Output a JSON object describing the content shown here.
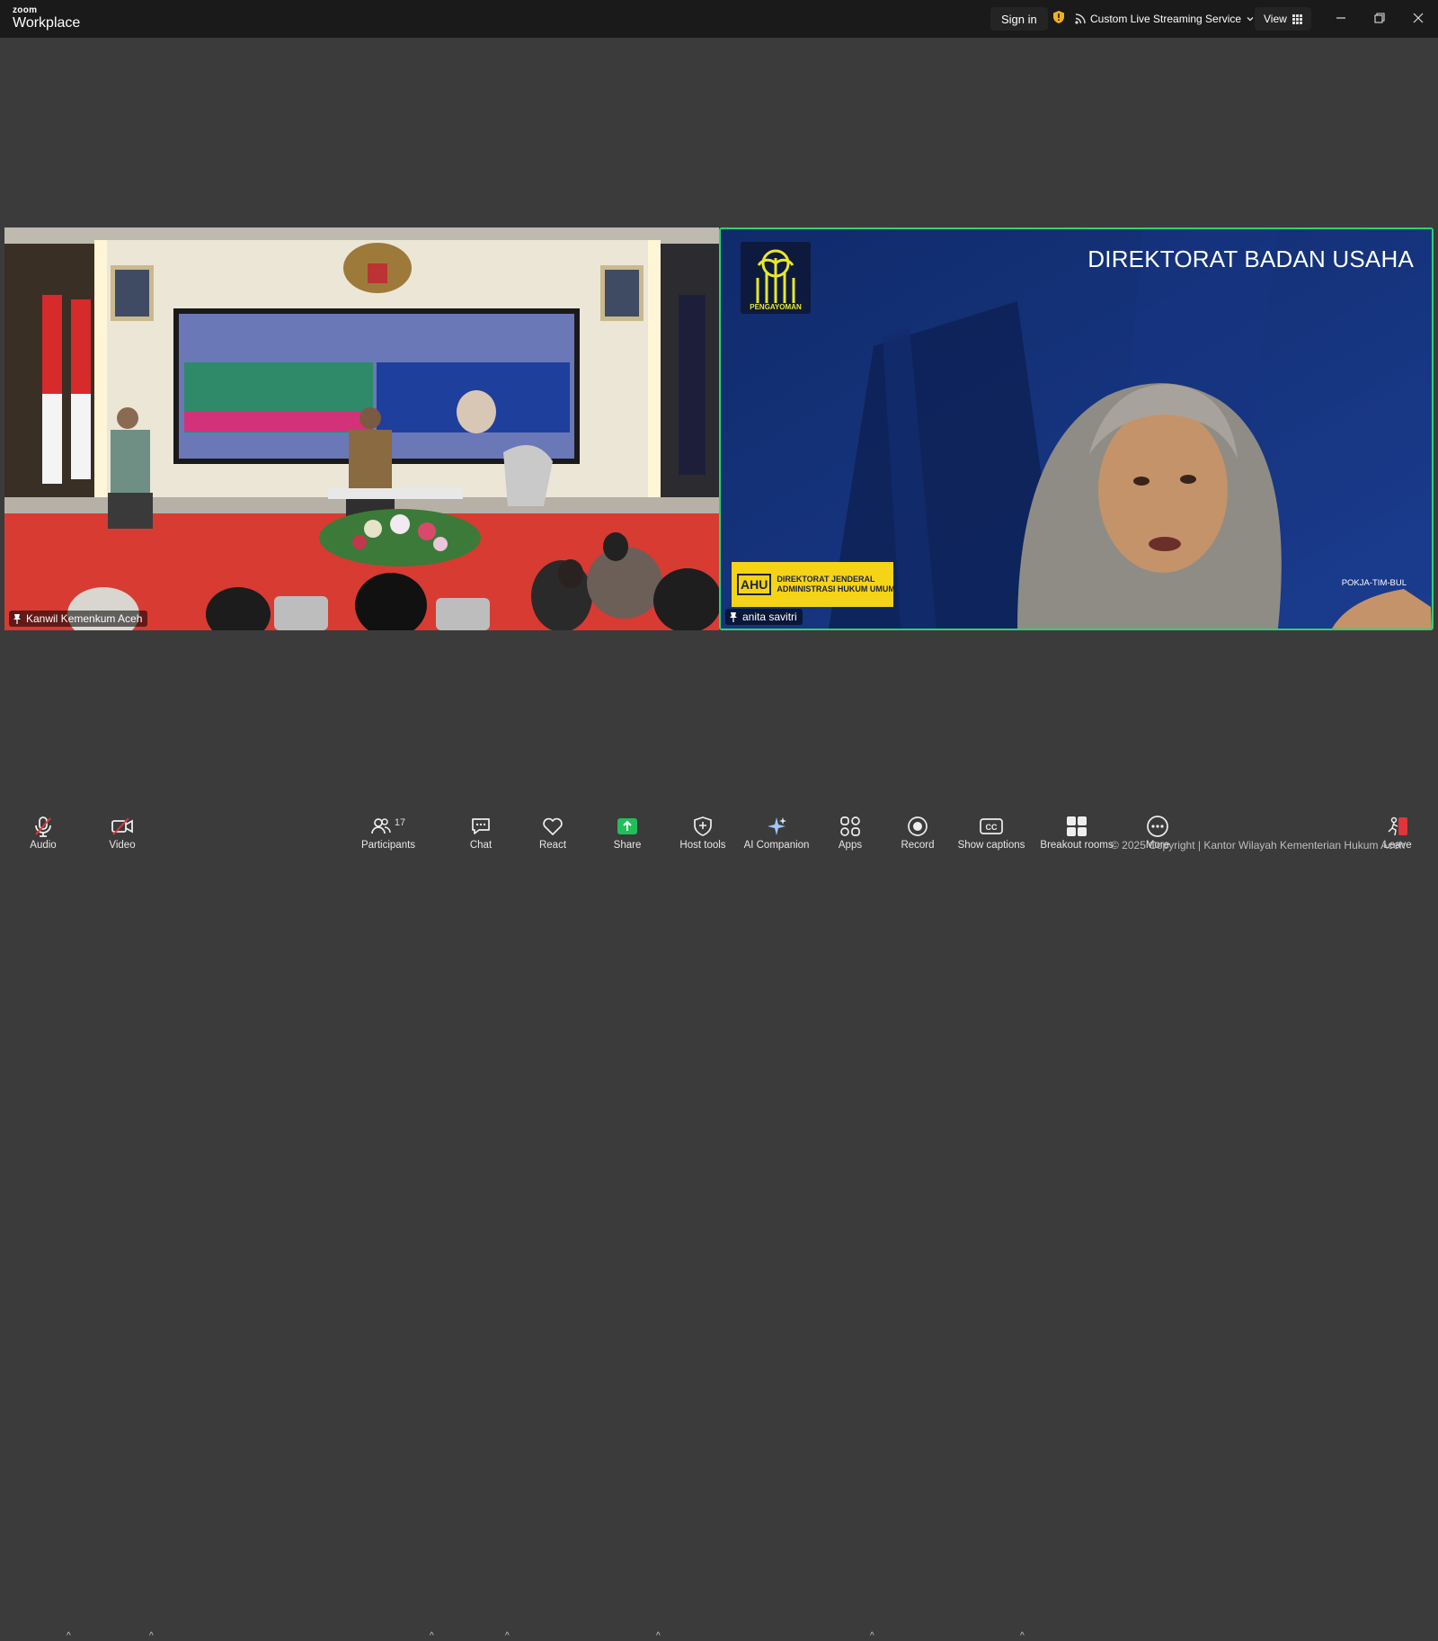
{
  "app": {
    "brand_small": "zoom",
    "brand_large": "Workplace"
  },
  "titlebar": {
    "signin_label": "Sign in",
    "stream_label": "Custom Live Streaming Service",
    "view_label": "View"
  },
  "tiles": {
    "left": {
      "name": "Kanwil Kemenkum Aceh"
    },
    "right": {
      "name": "anita savitri",
      "headline": "DIREKTORAT BADAN USAHA",
      "logo_caption": "PENGAYOMAN",
      "banner_line1": "DIREKTORAT JENDERAL",
      "banner_line2": "ADMINISTRASI HUKUM UMUM",
      "banner_mark": "AHU",
      "corner_text": "POKJA-TIM-BUL"
    }
  },
  "toolbar": {
    "audio": "Audio",
    "video": "Video",
    "participants": "Participants",
    "participants_count": "17",
    "chat": "Chat",
    "react": "React",
    "share": "Share",
    "host_tools": "Host tools",
    "ai_companion": "AI Companion",
    "apps": "Apps",
    "record": "Record",
    "show_captions": "Show captions",
    "breakout_rooms": "Breakout rooms",
    "more": "More",
    "leave": "Leave"
  },
  "watermark": "© 2025 Copyright | Kantor Wilayah Kementerian Hukum Aceh",
  "colors": {
    "active_speaker": "#2bd46f",
    "share": "#1fbf5a",
    "leave": "#e0353b"
  }
}
